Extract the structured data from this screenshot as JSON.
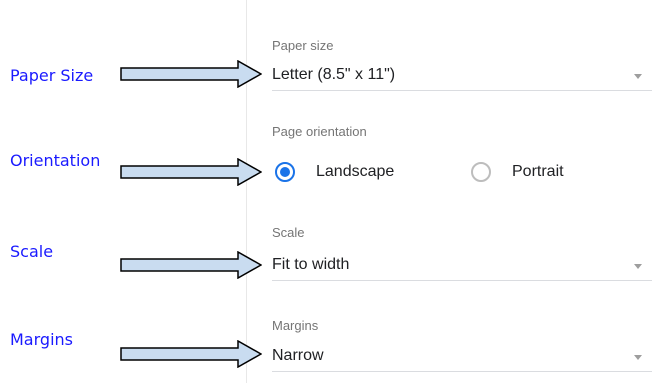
{
  "annotations": {
    "paper_size": "Paper Size",
    "orientation": "Orientation",
    "scale": "Scale",
    "margins": "Margins"
  },
  "settings": {
    "paper_size": {
      "label": "Paper size",
      "value": "Letter (8.5\" x 11\")"
    },
    "orientation": {
      "label": "Page orientation",
      "options": [
        "Landscape",
        "Portrait"
      ],
      "selected": "Landscape"
    },
    "scale": {
      "label": "Scale",
      "value": "Fit to width"
    },
    "margins": {
      "label": "Margins",
      "value": "Narrow"
    }
  },
  "colors": {
    "annotation_text": "#1a1aff",
    "arrow_fill": "#c9dcf0",
    "arrow_stroke": "#000000",
    "radio_accent": "#1a73e8"
  },
  "icons": {
    "arrow": "right-arrow-icon",
    "caret": "caret-down-icon"
  }
}
